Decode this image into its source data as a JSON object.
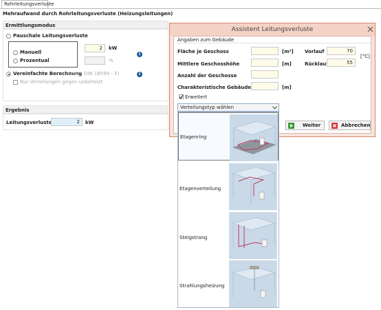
{
  "tab": {
    "label": "Rohrleitungsverluste"
  },
  "page": {
    "title": "Mehraufwand durch Rohrleitungsverluste (Heizungsleitungen)"
  },
  "ermittlung": {
    "header": "Ermittlungsmodus",
    "pauschal_label": "Pauschale Leitungsverluste",
    "manuell_label": "Manuell",
    "manuell_value": "2",
    "manuell_unit": "kW",
    "prozentual_label": "Prozentual",
    "prozentual_unit": "%",
    "vereinfacht_label": "Vereinfachte Berechnung",
    "vereinfacht_note": "(nach DIN 18599 - 5)",
    "nur_verteilungen_label": "Nur Verteilungen gegen unbeheizt",
    "selected_mode": "Vereinfachte Berechnung"
  },
  "ergebnis": {
    "header": "Ergebnis",
    "leitungsverluste_label": "Leitungsverluste",
    "leitungsverluste_value": "2",
    "leitungsverluste_unit": "kW"
  },
  "assistent": {
    "title": "Assistent Leitungsverluste",
    "group_label": "Angaben zum Gebäude",
    "flaeche_label": "Fläche je Geschoss",
    "flaeche_unit": "[m²]",
    "hoehe_label": "Mittlere Geschosshöhe",
    "hoehe_unit": "[m]",
    "anzahl_label": "Anzahl der Geschosse",
    "laenge_label": "Charakteristische Gebäudelänge",
    "laenge_unit": "[m]",
    "vorlauf_label": "Vorlauf",
    "vorlauf_value": "70",
    "ruecklauf_label": "Rücklauf",
    "ruecklauf_value": "55",
    "temp_unit": "[°C]",
    "erweitert_label": "Erweitert",
    "dropdown_placeholder": "Verteilungstyp wählen",
    "weiter_label": "Weiter",
    "abbrechen_label": "Abbrechen",
    "options": [
      "Etagenring",
      "Etagenverteilung",
      "Steigstrang",
      "Strahlungsheizung"
    ]
  },
  "colors": {
    "dialog_border": "#d4866e",
    "dialog_title_bg": "#f5d2c6",
    "input_yellow": "#fffbe9",
    "input_blue": "#dff0fb",
    "info_icon": "#1c5a9c",
    "pipe_red": "#c0395a"
  }
}
